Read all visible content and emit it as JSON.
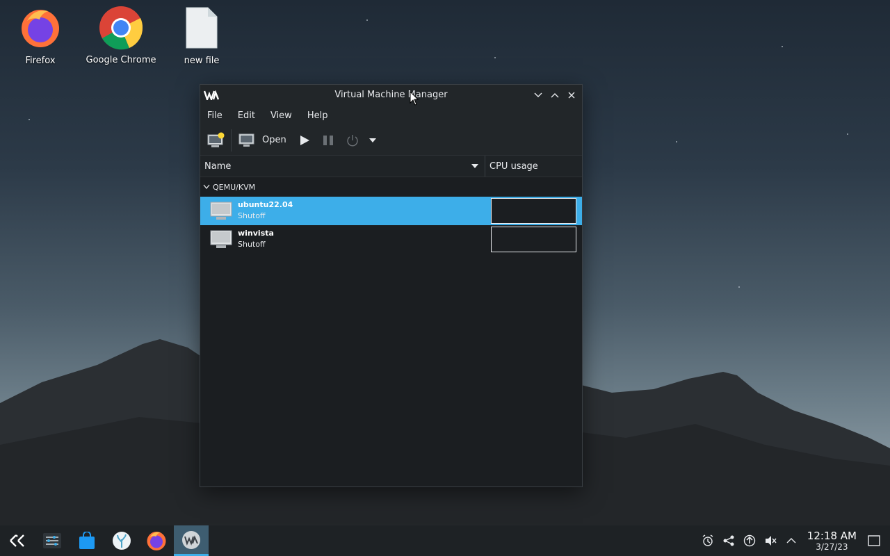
{
  "desktop": {
    "icons": [
      {
        "label": "Firefox"
      },
      {
        "label": "Google Chrome"
      },
      {
        "label": "new file"
      }
    ]
  },
  "window": {
    "title": "Virtual Machine Manager",
    "menu": [
      "File",
      "Edit",
      "View",
      "Help"
    ],
    "toolbar": {
      "open_label": "Open"
    },
    "columns": {
      "name": "Name",
      "cpu": "CPU usage"
    },
    "group": "QEMU/KVM",
    "vms": [
      {
        "name": "ubuntu22.04",
        "state": "Shutoff",
        "selected": true
      },
      {
        "name": "winvista",
        "state": "Shutoff",
        "selected": false
      }
    ]
  },
  "taskbar": {
    "time": "12:18 AM",
    "date": "3/27/23"
  },
  "colors": {
    "selection": "#3daee9",
    "window_bg": "#1b1e21",
    "taskbar_bg": "#1e2225"
  }
}
